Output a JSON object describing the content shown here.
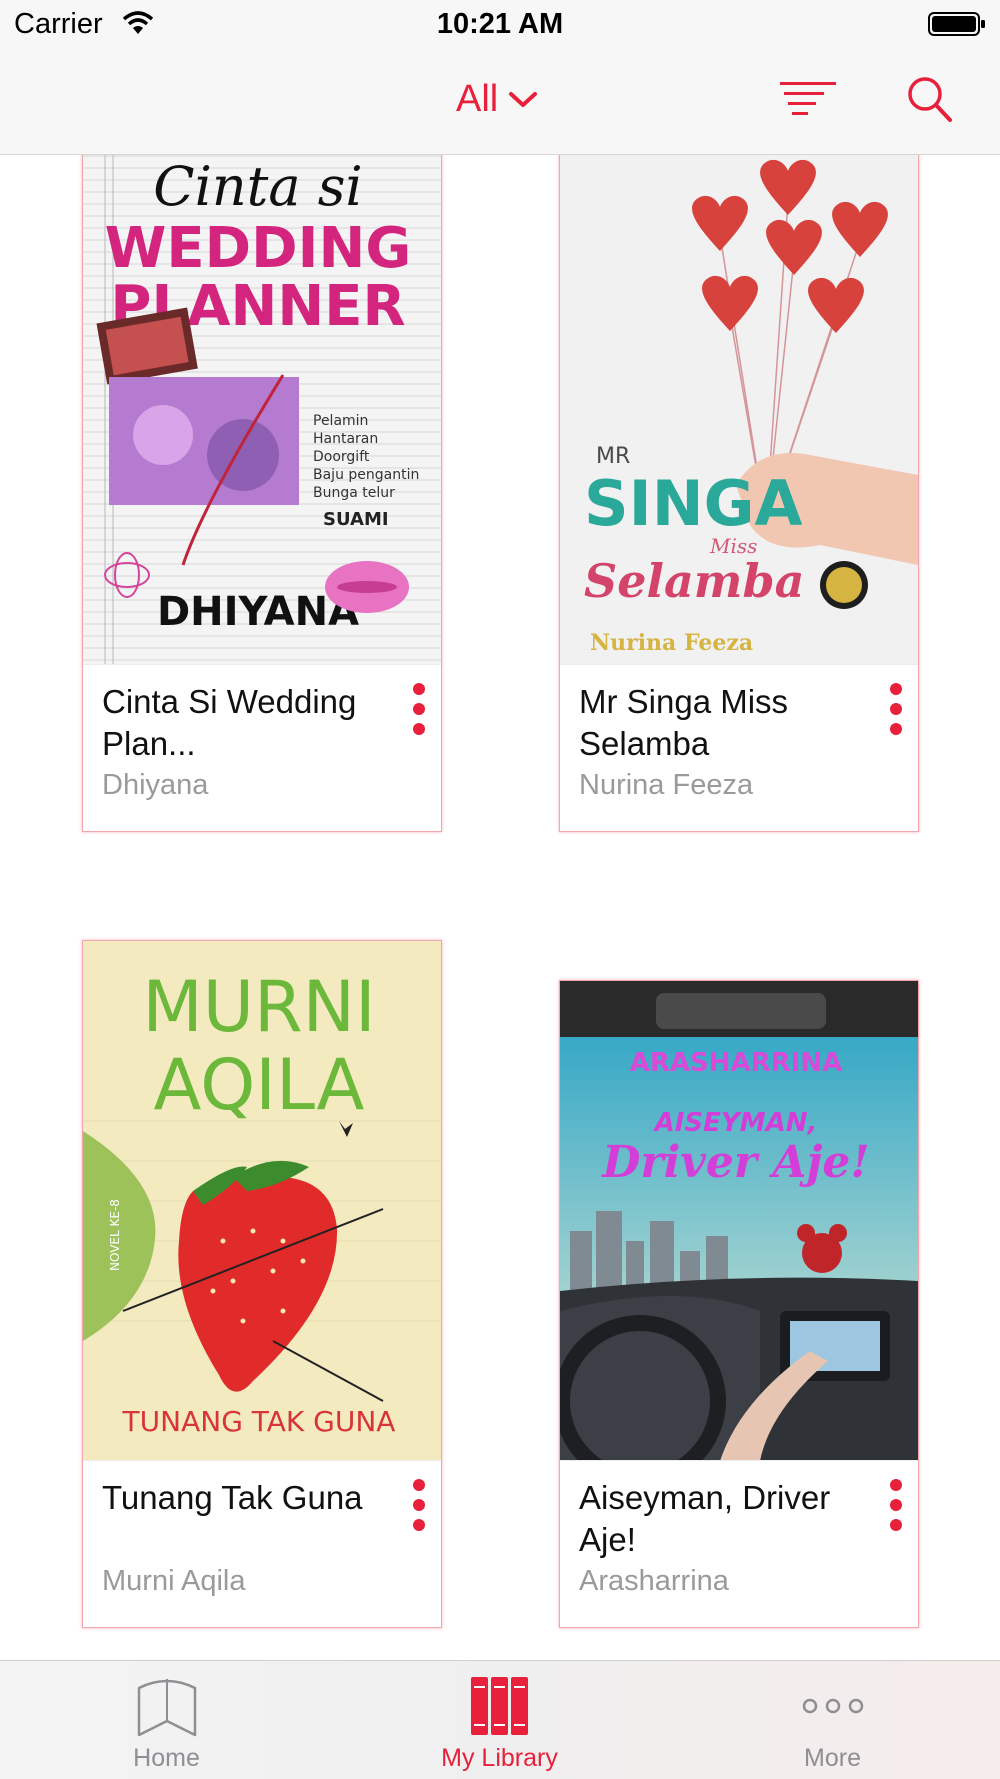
{
  "status_bar": {
    "carrier": "Carrier",
    "time": "10:21 AM"
  },
  "nav": {
    "filter_label": "All",
    "accent_color": "#e8203b"
  },
  "books": [
    {
      "title": "Cinta Si Wedding Plan...",
      "author": "Dhiyana",
      "cover": {
        "line1": "Cinta si",
        "line2": "WEDDING",
        "line3": "PLANNER",
        "footer": "DHIYANA"
      }
    },
    {
      "title": "Mr Singa Miss Selamba",
      "author": "Nurina Feeza",
      "cover": {
        "line1": "MR",
        "line2": "SINGA",
        "line3": "Miss",
        "line4": "Selamba",
        "footer": "Nurina Feeza"
      }
    },
    {
      "title": "Tunang Tak Guna",
      "author": "Murni Aqila",
      "cover": {
        "line1": "MURNI",
        "line2": "AQILA",
        "side": "NOVEL KE-8",
        "footer": "TUNANG TAK GUNA"
      }
    },
    {
      "title": "Aiseyman, Driver Aje!",
      "author": "Arasharrina",
      "cover": {
        "line1": "ARASHARRINA",
        "line2": "AISEYMAN,",
        "line3": "Driver Aje!"
      }
    }
  ],
  "tabs": [
    {
      "label": "Home",
      "active": false
    },
    {
      "label": "My Library",
      "active": true
    },
    {
      "label": "More",
      "active": false
    }
  ]
}
